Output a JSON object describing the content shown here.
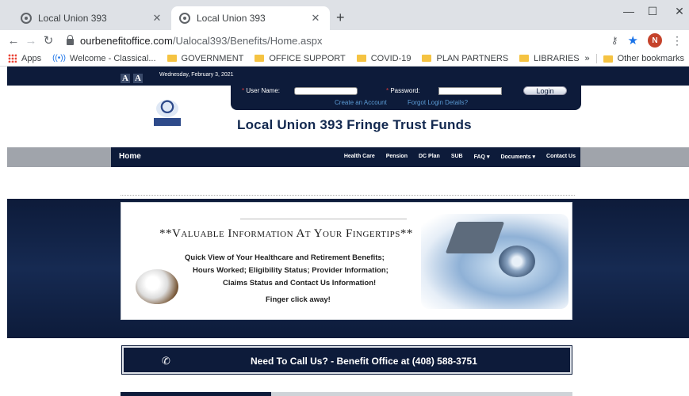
{
  "browser": {
    "tabs": [
      {
        "title": "Local Union 393",
        "active": false
      },
      {
        "title": "Local Union 393",
        "active": true
      }
    ],
    "new_tab": "+",
    "url_host": "ourbenefitoffice.com",
    "url_path": "/Ualocal393/Benefits/Home.aspx",
    "bookmarks": [
      "Apps",
      "Welcome - Classical...",
      "GOVERNMENT",
      "OFFICE SUPPORT",
      "COVID-19",
      "PLAN PARTNERS",
      "LIBRARIES"
    ],
    "overflow": "»",
    "other_bookmarks": "Other bookmarks",
    "avatar_letter": "N"
  },
  "page": {
    "font_small": "A",
    "font_large": "A",
    "date": "Wednesday, February 3, 2021",
    "login": {
      "username_label": "User Name:",
      "password_label": "Password:",
      "login_button": "Login",
      "create_account": "Create an Account",
      "forgot_login": "Forgot Login Details?"
    },
    "site_title": "Local Union 393 Fringe Trust Funds",
    "nav": {
      "home": "Home",
      "items": [
        "Health Care",
        "Pension",
        "DC Plan",
        "SUB",
        "FAQ ▾",
        "Documents ▾",
        "Contact Us"
      ]
    },
    "banner": {
      "headline": "**Valuable Information At Your Fingertips**",
      "lines": [
        "Quick View of Your Healthcare and Retirement Benefits;",
        "Hours Worked; Eligibility Status; Provider Information;",
        "Claims Status and Contact Us Information!",
        "Finger click away!"
      ]
    },
    "callbar": "Need To Call Us? - Benefit Office at  (408) 588-3751"
  }
}
